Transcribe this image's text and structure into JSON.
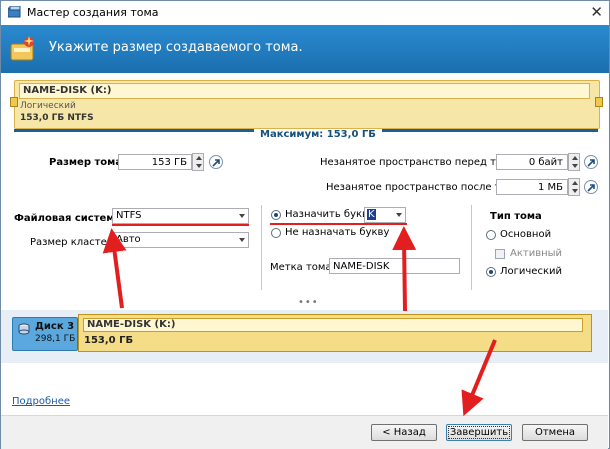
{
  "window": {
    "title": "Мастер создания тома"
  },
  "header": {
    "title": "Укажите размер создаваемого тома."
  },
  "volume_top": {
    "name": "NAME-DISK (K:)",
    "type": "Логический",
    "size": "153,0 ГБ NTFS"
  },
  "maximum_label": "Максимум: 153,0 ГБ",
  "size_field": {
    "label": "Размер тома:",
    "value": "153 ГБ"
  },
  "free_before": {
    "label": "Незанятое пространство перед томом:",
    "value": "0 байт"
  },
  "free_after": {
    "label": "Незанятое пространство после тома:",
    "value": "1 МБ"
  },
  "filesystem": {
    "label": "Файловая система:",
    "value": "NTFS"
  },
  "cluster": {
    "label": "Размер кластера:",
    "value": "Авто"
  },
  "letter": {
    "assign_label": "Назначить букву:",
    "assign_value": "K",
    "no_assign_label": "Не назначать букву",
    "selected": "assign"
  },
  "volume_label": {
    "label": "Метка тома:",
    "value": "NAME-DISK"
  },
  "volume_type": {
    "title": "Тип тома",
    "primary": "Основной",
    "active": "Активный",
    "logical": "Логический",
    "selected": "logical"
  },
  "disk_map": {
    "disk_name": "Диск 3",
    "disk_size": "298,1 ГБ",
    "volume_name": "NAME-DISK (K:)",
    "volume_size": "153,0 ГБ"
  },
  "details_link": "Подробнее",
  "buttons": {
    "back": "< Назад",
    "finish": "Завершить",
    "cancel": "Отмена"
  },
  "colors": {
    "header": "#1f7fc3",
    "volume": "#f6e7a8",
    "disk": "#5aa8de",
    "annotation": "#e21e1e"
  }
}
